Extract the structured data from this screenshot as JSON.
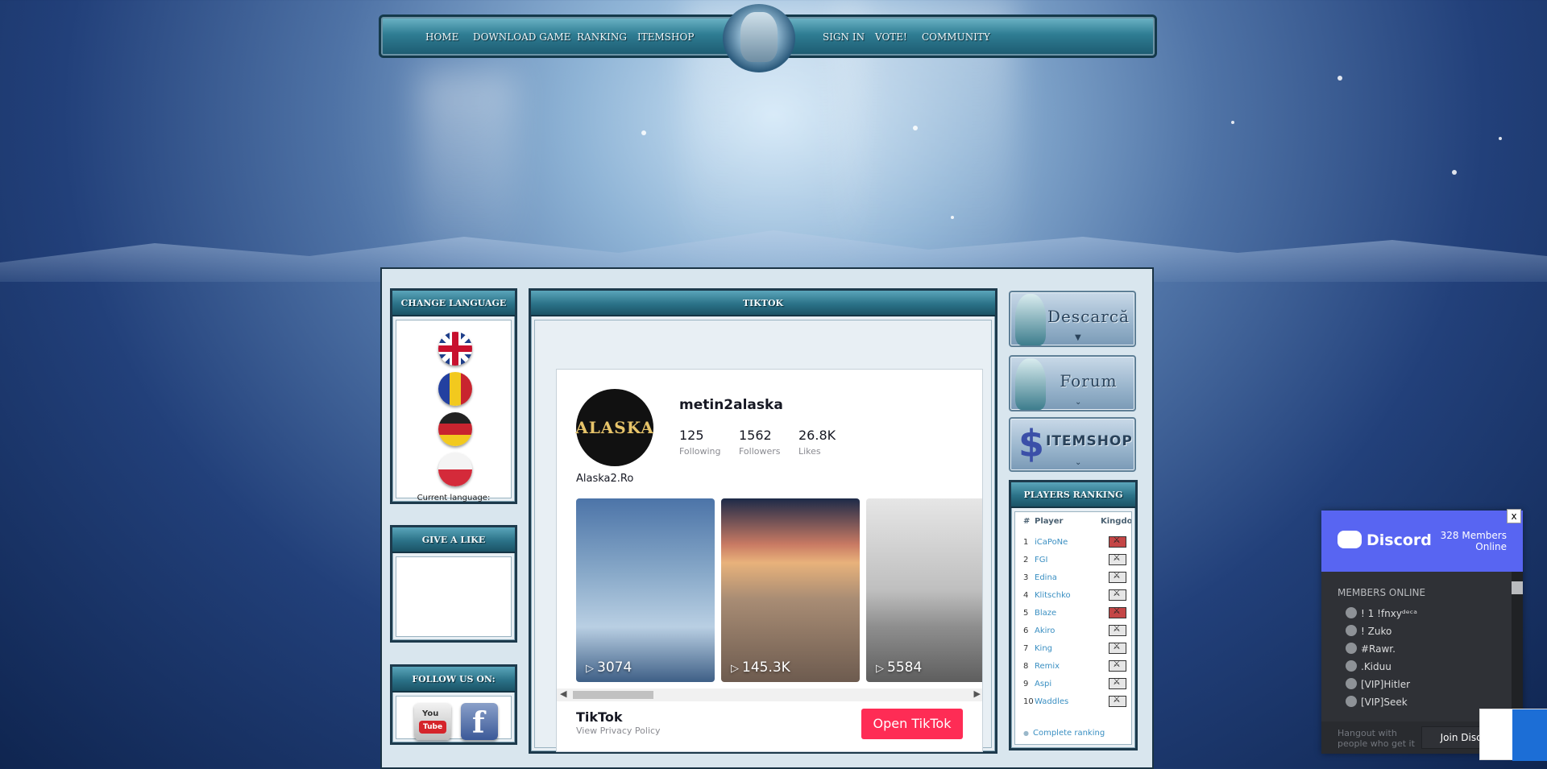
{
  "nav": {
    "left": [
      "HOME",
      "DOWNLOAD GAME",
      "RANKING",
      "ITEMSHOP"
    ],
    "right": [
      "SIGN IN",
      "VOTE!",
      "COMMUNITY"
    ]
  },
  "language": {
    "title": "CHANGE LANGUAGE",
    "current_label": "Current language:",
    "flags": [
      "uk-flag-icon",
      "romania-flag-icon",
      "germany-flag-icon",
      "poland-flag-icon"
    ]
  },
  "like": {
    "title": "GIVE A LIKE"
  },
  "follow": {
    "title": "FOLLOW US ON:",
    "youtube_label": "You",
    "youtube_tube": "Tube",
    "facebook_label": "f"
  },
  "tiktok": {
    "title": "TIKTOK",
    "avatar_text": "ALASKA",
    "username": "metin2alaska",
    "stats": [
      {
        "value": "125",
        "label": "Following"
      },
      {
        "value": "1562",
        "label": "Followers"
      },
      {
        "value": "26.8K",
        "label": "Likes"
      }
    ],
    "bio": "Alaska2.Ro",
    "videos": [
      {
        "views": "3074"
      },
      {
        "views": "145.3K"
      },
      {
        "views": "5584"
      }
    ],
    "brand": "TikTok",
    "privacy": "View Privacy Policy",
    "open_button": "Open TikTok"
  },
  "banners": {
    "download": "Descarcă",
    "forum": "Forum",
    "itemshop": "ITEMSHOP",
    "itemshop_symbol": "$"
  },
  "ranking": {
    "title": "PLAYERS RANKING",
    "headers": [
      "#",
      "Player",
      "Kingdom"
    ],
    "rows": [
      {
        "rank": "1",
        "player": "iCaPoNe",
        "kingdom": "red"
      },
      {
        "rank": "2",
        "player": "FGI",
        "kingdom": "gray"
      },
      {
        "rank": "3",
        "player": "Edina",
        "kingdom": "gray"
      },
      {
        "rank": "4",
        "player": "Klitschko",
        "kingdom": "gray"
      },
      {
        "rank": "5",
        "player": "Blaze",
        "kingdom": "red"
      },
      {
        "rank": "6",
        "player": "Akiro",
        "kingdom": "gray"
      },
      {
        "rank": "7",
        "player": "King",
        "kingdom": "gray"
      },
      {
        "rank": "8",
        "player": "Remix",
        "kingdom": "gray"
      },
      {
        "rank": "9",
        "player": "Aspi",
        "kingdom": "gray"
      },
      {
        "rank": "10",
        "player": "Waddles",
        "kingdom": "gray"
      }
    ],
    "complete_link": "Complete ranking"
  },
  "discord": {
    "brand": "Discord",
    "members_online": "328 Members Online",
    "close": "x",
    "section": "MEMBERS ONLINE",
    "members": [
      "! 1 !fnxyᵈᵉᶜᵃ",
      "! Zuko",
      "#Rawr.",
      ".Kiduu",
      "[VIP]Hitler",
      "[VIP]Seek"
    ],
    "hangout": "Hangout with people who get it",
    "join_button": "Join Discord"
  }
}
